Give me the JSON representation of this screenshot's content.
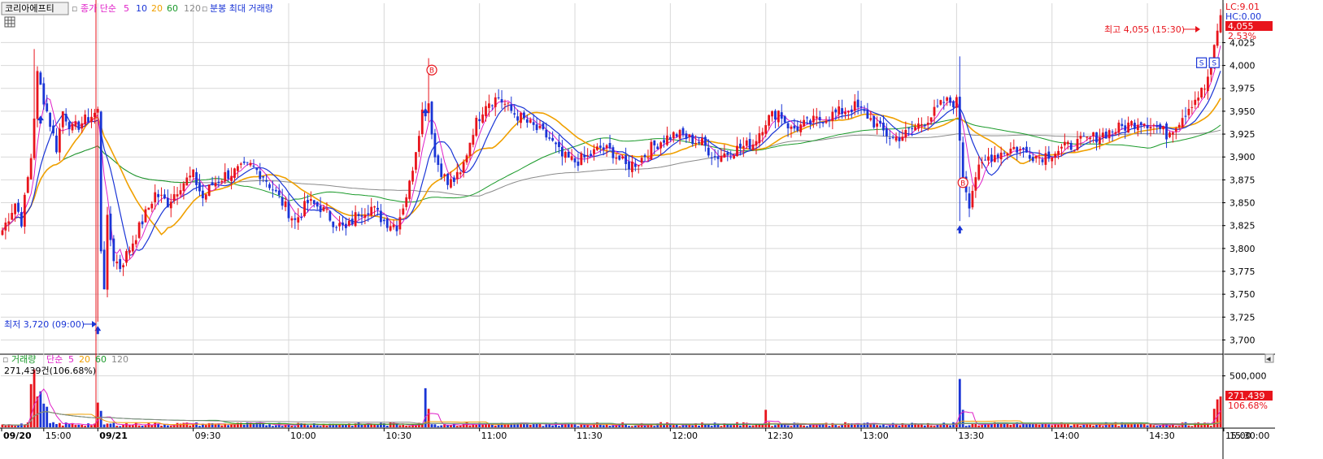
{
  "header": {
    "stock_name": "코리아에프티",
    "price_label": "종가 단순",
    "price_ma_periods": [
      "5",
      "10",
      "20",
      "60",
      "120"
    ],
    "bar_label": "분봉 최대 거래량"
  },
  "volume_header": {
    "label": "거래량",
    "ma_label": "단순",
    "ma_periods": [
      "5",
      "20",
      "60",
      "120"
    ],
    "readout": "271,439건(106.68%)"
  },
  "right_panel": {
    "lc": "LC:9.01",
    "hc": "HC:0.00",
    "last_price": "4,055",
    "last_change": "2.53%",
    "last_volume": "271,439",
    "last_volume_pct": "106.68%"
  },
  "annotations": {
    "high": "최고 4,055 (15:30)",
    "low": "최저 3,720 (09:00)",
    "buy": "B",
    "sell": "S"
  },
  "colors": {
    "up": "#e8141c",
    "down": "#1a35d6",
    "ma5": "#e020c8",
    "ma10": "#1a35d6",
    "ma20": "#f0a000",
    "ma60": "#1a9a2a",
    "ma120": "#8a8a8a",
    "grid": "#d8d8d8"
  },
  "chart_data": {
    "type": "candlestick",
    "price_axis": {
      "min": 3700,
      "max": 4055,
      "ticks": [
        "3,700",
        "3,725",
        "3,750",
        "3,775",
        "3,800",
        "3,825",
        "3,850",
        "3,875",
        "3,900",
        "3,925",
        "3,950",
        "3,975",
        "4,000",
        "4,025"
      ]
    },
    "volume_axis": {
      "max": 600000,
      "ticks": [
        "500,000"
      ]
    },
    "x_ticks": [
      {
        "label": "09/20",
        "bold": true
      },
      {
        "label": "15:00",
        "bold": false
      },
      {
        "label": "09/21",
        "bold": true
      },
      {
        "label": "09:30",
        "bold": false
      },
      {
        "label": "10:00",
        "bold": false
      },
      {
        "label": "10:30",
        "bold": false
      },
      {
        "label": "11:00",
        "bold": false
      },
      {
        "label": "11:30",
        "bold": false
      },
      {
        "label": "12:00",
        "bold": false
      },
      {
        "label": "12:30",
        "bold": false
      },
      {
        "label": "13:00",
        "bold": false
      },
      {
        "label": "13:30",
        "bold": false
      },
      {
        "label": "14:00",
        "bold": false
      },
      {
        "label": "14:30",
        "bold": false
      },
      {
        "label": "15:00",
        "bold": false
      },
      {
        "label": "15:30:00",
        "bold": false
      }
    ],
    "price_path": [
      [
        0,
        3820
      ],
      [
        4,
        3850
      ],
      [
        6,
        3830
      ],
      [
        9,
        3900
      ],
      [
        11,
        3990
      ],
      [
        14,
        3950
      ],
      [
        17,
        3910
      ],
      [
        19,
        3950
      ],
      [
        22,
        3930
      ],
      [
        26,
        3940
      ],
      [
        30,
        3950
      ],
      [
        31,
        3800
      ],
      [
        32,
        3760
      ],
      [
        33,
        3830
      ],
      [
        35,
        3790
      ],
      [
        37,
        3780
      ],
      [
        40,
        3800
      ],
      [
        44,
        3830
      ],
      [
        48,
        3860
      ],
      [
        52,
        3850
      ],
      [
        56,
        3870
      ],
      [
        60,
        3880
      ],
      [
        63,
        3855
      ],
      [
        66,
        3870
      ],
      [
        70,
        3880
      ],
      [
        74,
        3885
      ],
      [
        78,
        3890
      ],
      [
        82,
        3880
      ],
      [
        86,
        3860
      ],
      [
        90,
        3840
      ],
      [
        92,
        3830
      ],
      [
        96,
        3850
      ],
      [
        100,
        3845
      ],
      [
        104,
        3830
      ],
      [
        108,
        3820
      ],
      [
        112,
        3840
      ],
      [
        116,
        3845
      ],
      [
        120,
        3830
      ],
      [
        124,
        3825
      ],
      [
        128,
        3870
      ],
      [
        132,
        3950
      ],
      [
        134,
        3960
      ],
      [
        136,
        3900
      ],
      [
        140,
        3870
      ],
      [
        144,
        3880
      ],
      [
        148,
        3930
      ],
      [
        152,
        3960
      ],
      [
        156,
        3965
      ],
      [
        160,
        3950
      ],
      [
        164,
        3940
      ],
      [
        168,
        3930
      ],
      [
        172,
        3920
      ],
      [
        176,
        3900
      ],
      [
        180,
        3895
      ],
      [
        184,
        3900
      ],
      [
        188,
        3910
      ],
      [
        192,
        3905
      ],
      [
        196,
        3890
      ],
      [
        200,
        3895
      ],
      [
        204,
        3910
      ],
      [
        208,
        3920
      ],
      [
        212,
        3925
      ],
      [
        216,
        3920
      ],
      [
        220,
        3915
      ],
      [
        224,
        3900
      ],
      [
        228,
        3905
      ],
      [
        232,
        3910
      ],
      [
        236,
        3915
      ],
      [
        240,
        3940
      ],
      [
        244,
        3950
      ],
      [
        248,
        3930
      ],
      [
        252,
        3935
      ],
      [
        256,
        3940
      ],
      [
        260,
        3945
      ],
      [
        264,
        3950
      ],
      [
        268,
        3955
      ],
      [
        272,
        3945
      ],
      [
        276,
        3930
      ],
      [
        280,
        3920
      ],
      [
        284,
        3925
      ],
      [
        288,
        3935
      ],
      [
        292,
        3945
      ],
      [
        296,
        3960
      ],
      [
        300,
        3960
      ],
      [
        302,
        3880
      ],
      [
        304,
        3850
      ],
      [
        306,
        3880
      ],
      [
        310,
        3900
      ],
      [
        314,
        3905
      ],
      [
        318,
        3910
      ],
      [
        322,
        3905
      ],
      [
        326,
        3900
      ],
      [
        330,
        3905
      ],
      [
        334,
        3910
      ],
      [
        338,
        3915
      ],
      [
        342,
        3920
      ],
      [
        346,
        3925
      ],
      [
        350,
        3930
      ],
      [
        354,
        3935
      ],
      [
        358,
        3940
      ],
      [
        362,
        3935
      ],
      [
        366,
        3925
      ],
      [
        370,
        3940
      ],
      [
        374,
        3960
      ],
      [
        378,
        3975
      ],
      [
        380,
        4000
      ],
      [
        382,
        4040
      ],
      [
        383,
        4055
      ]
    ],
    "price_markers": [
      {
        "idx": 12,
        "price": 3940,
        "type": "buy-arrow"
      },
      {
        "idx": 30,
        "price": 3710,
        "type": "buy-arrow"
      },
      {
        "idx": 133,
        "price": 3948,
        "type": "buy-arrow"
      },
      {
        "idx": 301,
        "price": 3820,
        "type": "buy-arrow"
      },
      {
        "idx": 135,
        "price": 3995,
        "type": "buy-circle"
      },
      {
        "idx": 302,
        "price": 3872,
        "type": "buy-circle"
      },
      {
        "idx": 377,
        "price": 4003,
        "type": "sell-box"
      },
      {
        "idx": 381,
        "price": 4003,
        "type": "sell-box"
      }
    ],
    "volume_peaks": [
      {
        "idx": 9,
        "value": 420000
      },
      {
        "idx": 10,
        "value": 560000
      },
      {
        "idx": 11,
        "value": 300000
      },
      {
        "idx": 12,
        "value": 350000
      },
      {
        "idx": 13,
        "value": 230000
      },
      {
        "idx": 14,
        "value": 200000
      },
      {
        "idx": 30,
        "value": 240000
      },
      {
        "idx": 31,
        "value": 160000
      },
      {
        "idx": 133,
        "value": 380000
      },
      {
        "idx": 134,
        "value": 180000
      },
      {
        "idx": 240,
        "value": 170000
      },
      {
        "idx": 301,
        "value": 470000
      },
      {
        "idx": 302,
        "value": 170000
      },
      {
        "idx": 381,
        "value": 180000
      },
      {
        "idx": 382,
        "value": 271439
      },
      {
        "idx": 383,
        "value": 300000
      }
    ]
  }
}
